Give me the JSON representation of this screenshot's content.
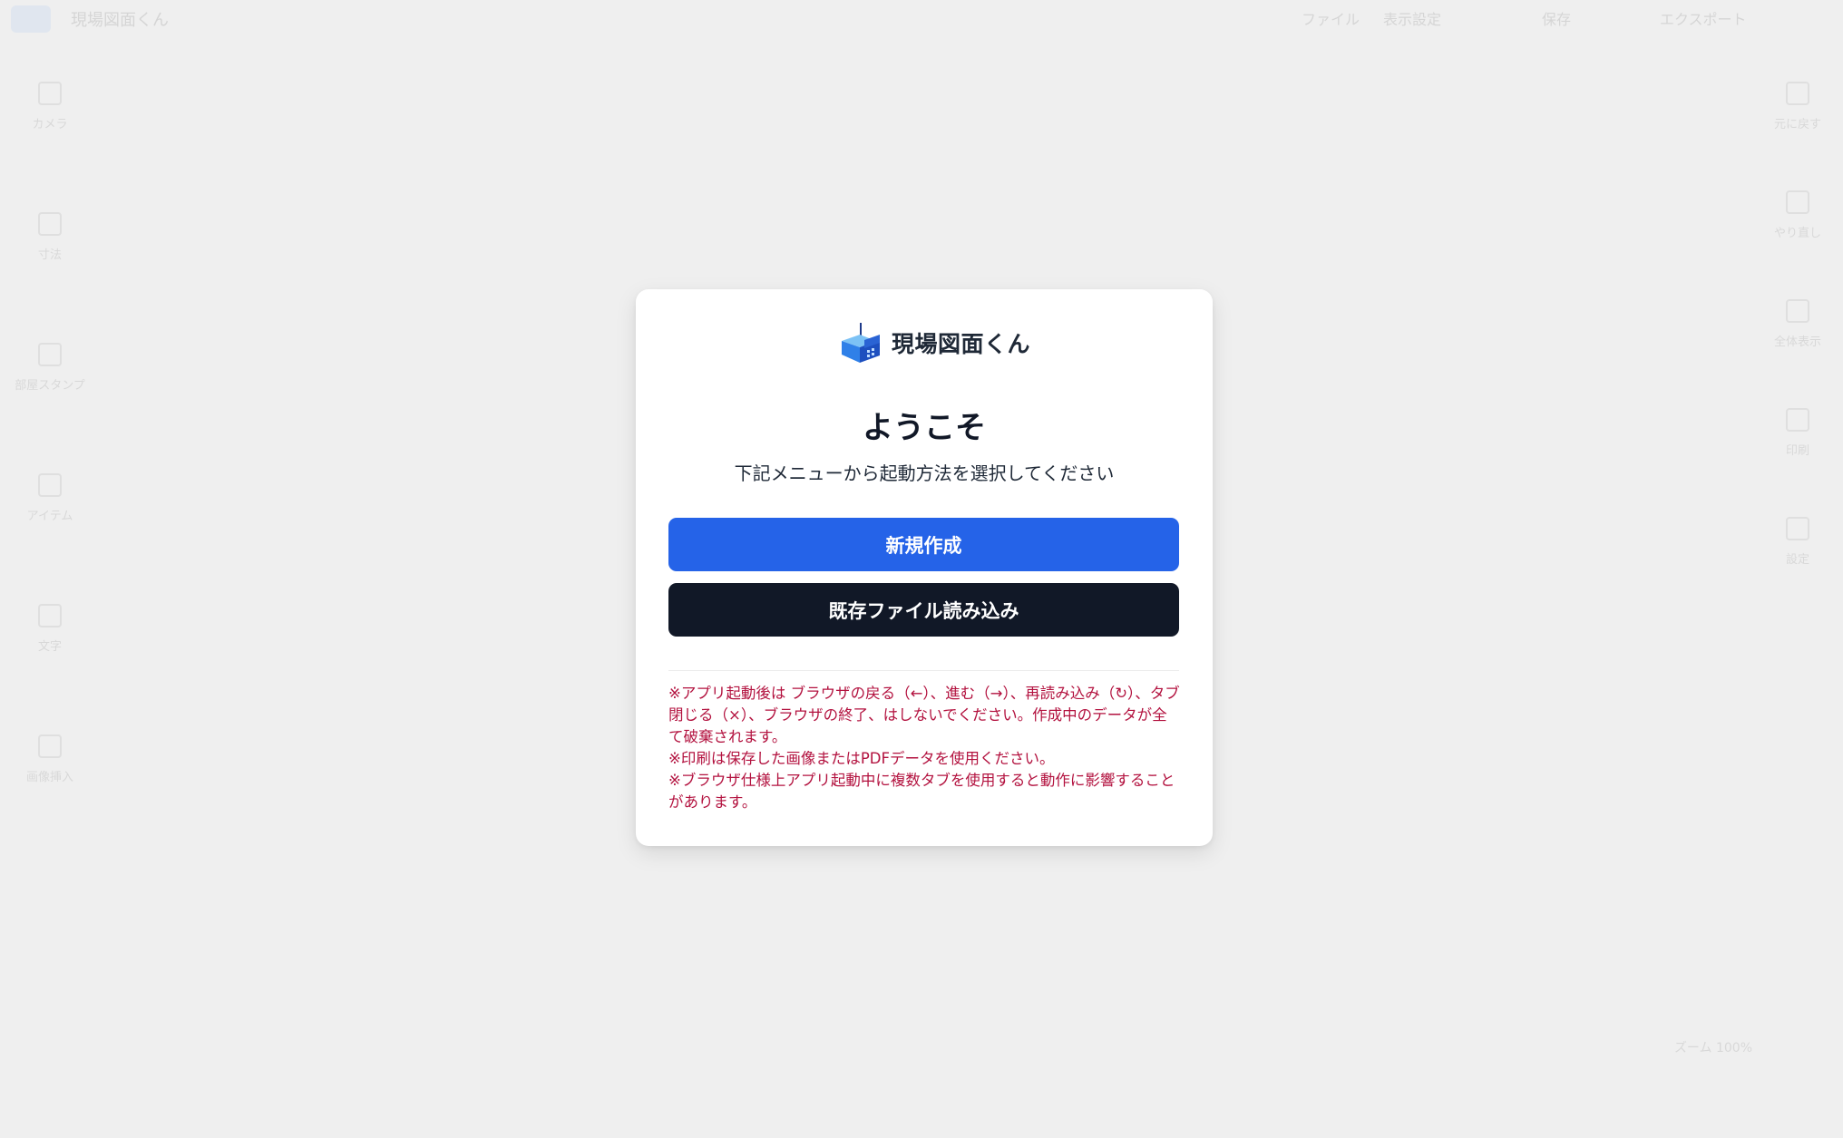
{
  "background": {
    "app_name": "現場図面くん",
    "top_right": [
      "ファイル",
      "表示設定",
      "保存",
      "エクスポート"
    ],
    "left_rail": [
      "カメラ",
      "寸法",
      "部屋スタンプ",
      "アイテム",
      "文字",
      "画像挿入"
    ],
    "right_rail": [
      "元に戻す",
      "やり直し",
      "全体表示",
      "印刷",
      "設定"
    ],
    "bottom_right": "ズーム 100%"
  },
  "dialog": {
    "brand_name": "現場図面くん",
    "welcome": "ようこそ",
    "subtitle": "下記メニューから起動方法を選択してください",
    "new_button": "新規作成",
    "open_button": "既存ファイル読み込み",
    "notes": [
      "※アプリ起動後は ブラウザの戻る（←）、進む（→）、再読み込み（↻）、タブ閉じる（×）、ブラウザの終了、はしないでください。作成中のデータが全て破棄されます。",
      "※印刷は保存した画像またはPDFデータを使用ください。",
      "※ブラウザ仕様上アプリ起動中に複数タブを使用すると動作に影響することがあります。"
    ]
  },
  "colors": {
    "primary": "#2563e8",
    "dark": "#111827",
    "warning_text": "#b3123f",
    "backdrop": "#efefef"
  }
}
